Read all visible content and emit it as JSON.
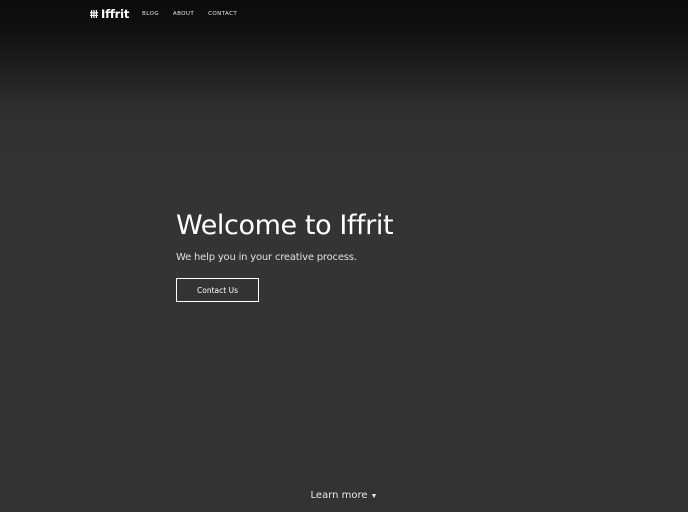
{
  "navbar": {
    "brand": {
      "icon": "grid-hash-icon",
      "name": "Iffrit"
    },
    "links": [
      {
        "label": "BLOG"
      },
      {
        "label": "ABOUT"
      },
      {
        "label": "CONTACT"
      }
    ]
  },
  "hero": {
    "title": "Welcome to Iffrit",
    "subtitle": "We help you in your creative process.",
    "cta_label": "Contact Us"
  },
  "footer": {
    "learn_more_label": "Learn more",
    "learn_more_icon": "caret-down-icon"
  },
  "colors": {
    "background": "#333333",
    "header_dark": "#0b0b0b",
    "text": "#ffffff"
  }
}
